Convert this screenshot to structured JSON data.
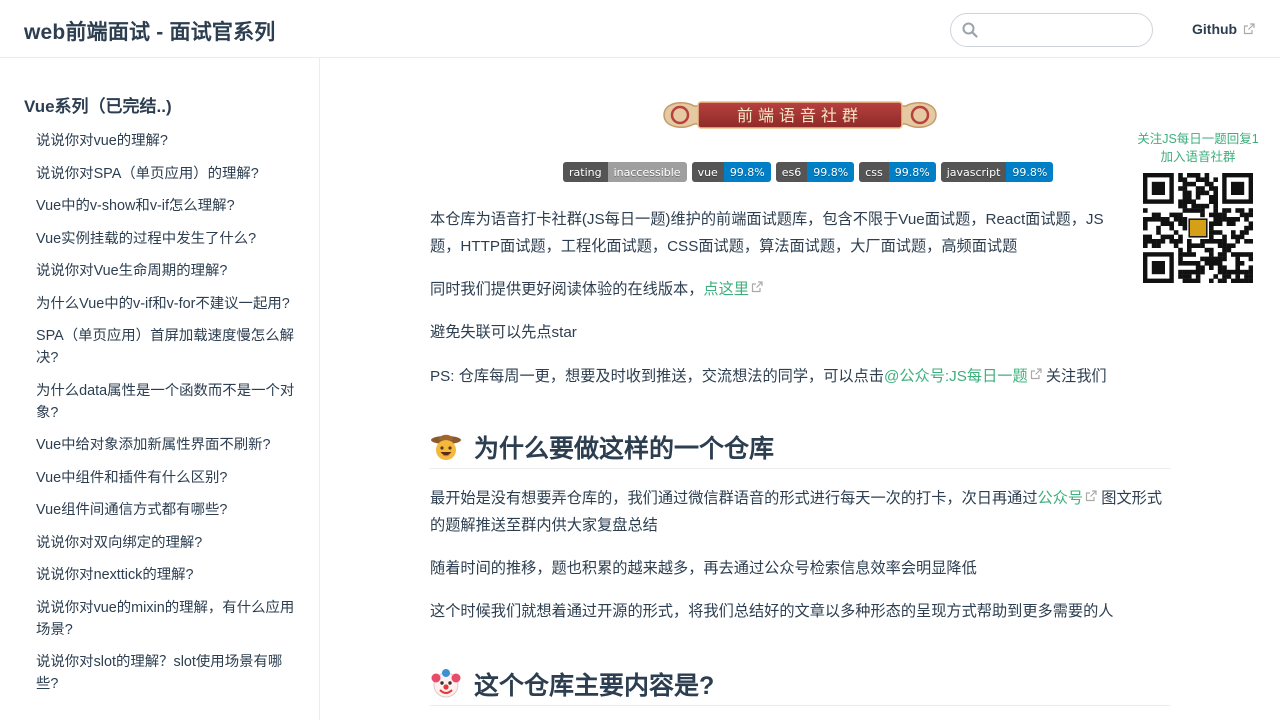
{
  "navbar": {
    "site_name": "web前端面试 - 面试官系列",
    "search_placeholder": "",
    "github_label": "Github",
    "search_icon": "search-icon",
    "external_icon": "external-link-icon"
  },
  "sidebar": {
    "heading": "Vue系列（已完结..)",
    "items": [
      "说说你对vue的理解?",
      "说说你对SPA（单页应用）的理解?",
      "Vue中的v-show和v-if怎么理解?",
      "Vue实例挂载的过程中发生了什么?",
      "说说你对Vue生命周期的理解?",
      "为什么Vue中的v-if和v-for不建议一起用?",
      "SPA（单页应用）首屏加载速度慢怎么解决?",
      "为什么data属性是一个函数而不是一个对象?",
      "Vue中给对象添加新属性界面不刷新?",
      "Vue中组件和插件有什么区别?",
      "Vue组件间通信方式都有哪些?",
      "说说你对双向绑定的理解?",
      "说说你对nexttick的理解?",
      "说说你对vue的mixin的理解，有什么应用场景?",
      "说说你对slot的理解？slot使用场景有哪些?"
    ]
  },
  "main": {
    "banner_text": "前端语音社群",
    "badges": [
      {
        "label": "rating",
        "value": "inaccessible",
        "value_color": "#9f9f9f"
      },
      {
        "label": "vue",
        "value": "99.8%",
        "value_color": "#007ec6"
      },
      {
        "label": "es6",
        "value": "99.8%",
        "value_color": "#007ec6"
      },
      {
        "label": "css",
        "value": "99.8%",
        "value_color": "#007ec6"
      },
      {
        "label": "javascript",
        "value": "99.8%",
        "value_color": "#007ec6"
      }
    ],
    "intro": "本仓库为语音打卡社群(JS每日一题)维护的前端面试题库，包含不限于Vue面试题，React面试题，JS题，HTTP面试题，工程化面试题，CSS面试题，算法面试题，大厂面试题，高频面试题",
    "online_prefix": "同时我们提供更好阅读体验的在线版本，",
    "online_link": "点这里",
    "star_text": "避免失联可以先点star",
    "ps_prefix": "PS: 仓库每周一更，想要及时收到推送，交流想法的同学，可以点击",
    "ps_link": "@公众号:JS每日一题",
    "ps_suffix": " 关注我们",
    "h2_why": "为什么要做这样的一个仓库",
    "why_p1_prefix": "最开始是没有想要弄仓库的，我们通过微信群语音的形式进行每天一次的打卡，次日再通过",
    "why_p1_link": "公众号",
    "why_p1_suffix": " 图文形式的题解推送至群内供大家复盘总结",
    "why_p2": "随着时间的推移，题也积累的越来越多，再去通过公众号检索信息效率会明显降低",
    "why_p3": "这个时候我们就想着通过开源的形式，将我们总结好的文章以多种形态的呈现方式帮助到更多需要的人",
    "h2_content": "这个仓库主要内容是?",
    "h2_why_icon": "cowboy-emoji-icon",
    "h2_content_icon": "clown-emoji-icon"
  },
  "qr_widget": {
    "line1": "关注JS每日一题回复1",
    "line2": "加入语音社群"
  },
  "colors": {
    "accent": "#3eaf7c",
    "text": "#2c3e50",
    "border": "#eaecef"
  }
}
